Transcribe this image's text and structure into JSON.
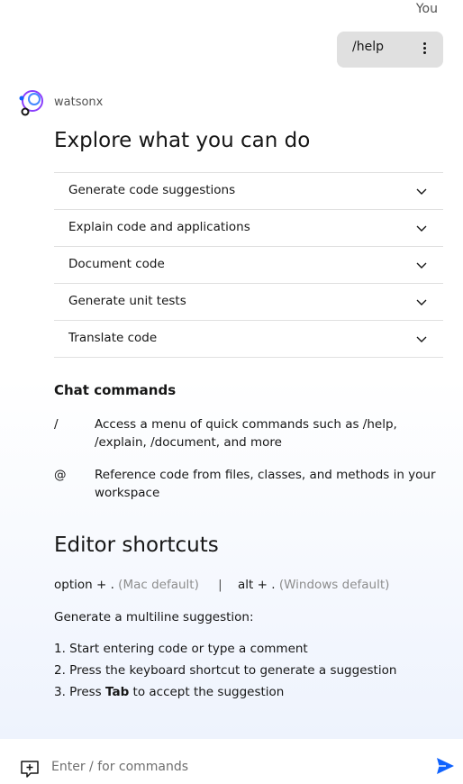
{
  "header": {
    "you_label": "You"
  },
  "user_message": {
    "text": "/help"
  },
  "bot": {
    "name": "watsonx"
  },
  "explore": {
    "title": "Explore what you can do",
    "items": [
      {
        "label": "Generate code suggestions"
      },
      {
        "label": "Explain code and applications"
      },
      {
        "label": "Document code"
      },
      {
        "label": "Generate unit tests"
      },
      {
        "label": "Translate code"
      }
    ]
  },
  "chat_commands": {
    "title": "Chat commands",
    "items": [
      {
        "symbol": "/",
        "description": "Access a menu of quick commands such as /help, /explain, /document, and more"
      },
      {
        "symbol": "@",
        "description": "Reference code from files, classes, and methods in your workspace"
      }
    ]
  },
  "editor_shortcuts": {
    "title": "Editor shortcuts",
    "mac_keys": "option + .",
    "mac_note": "(Mac default)",
    "separator": "|",
    "win_keys": "alt + .",
    "win_note": "(Windows default)",
    "intro": "Generate a multiline suggestion:",
    "steps": {
      "step1": "1. Start entering code or type a comment",
      "step2": "2. Press the keyboard shortcut to generate a suggestion",
      "step3_prefix": "3. Press ",
      "step3_key": "Tab",
      "step3_suffix": " to accept the suggestion"
    }
  },
  "composer": {
    "placeholder": "Enter / for commands"
  },
  "colors": {
    "accent": "#0f62fe",
    "bubble": "#e0e0e0",
    "muted": "#8d8d8d"
  }
}
